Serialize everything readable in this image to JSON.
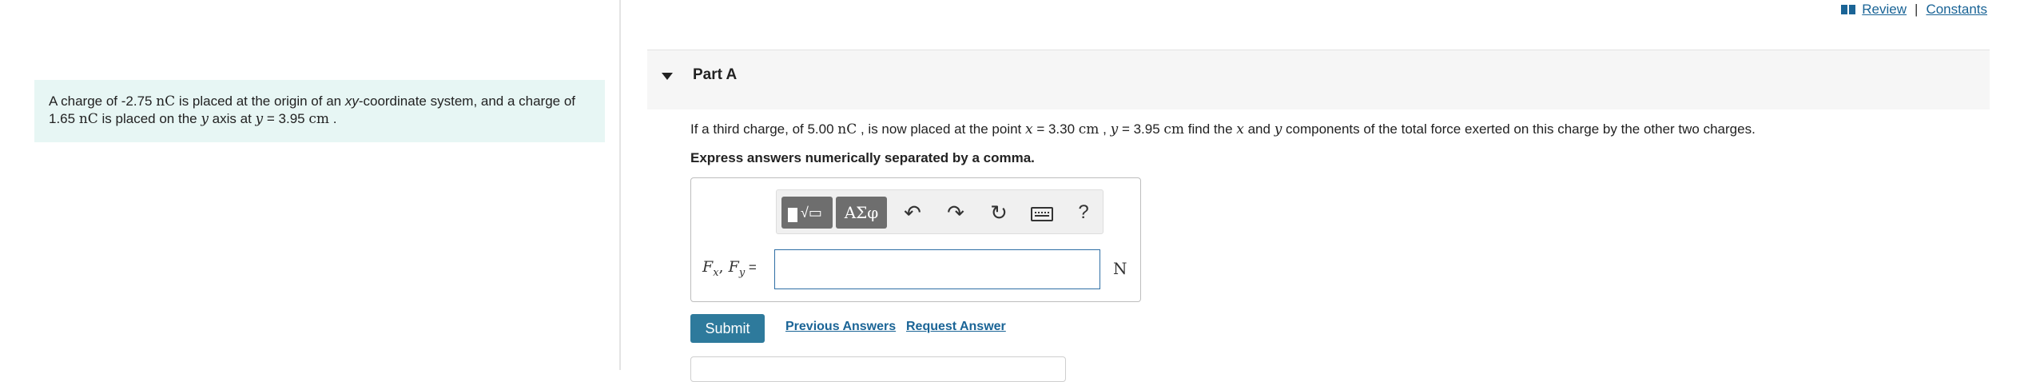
{
  "header": {
    "review": "Review",
    "separator": "|",
    "constants": "Constants"
  },
  "problem": {
    "t1": "A charge of ",
    "q1": "-2.75",
    "u1": "nC",
    "t2": " is placed at the origin of an ",
    "xy": "xy",
    "t3": "-coordinate system, and a charge of",
    "q2": "1.65",
    "u2": "nC",
    "t4": " is placed on the ",
    "yvar": "y",
    "t5": " axis at ",
    "yvar2": "y",
    "t6": " = 3.95 ",
    "u3": "cm",
    "t7": " ."
  },
  "part": {
    "title": "Part A"
  },
  "question": {
    "t1": "If a third charge, of 5.00 ",
    "u1": "nC",
    "t2": " , is now placed at the point ",
    "x": "x",
    "t3": " = 3.30 ",
    "u2": "cm",
    "t4": " , ",
    "y": "y",
    "t5": " = 3.95 ",
    "u3": "cm",
    "t6": " find the ",
    "x2": "x",
    "t7": " and ",
    "y2": "y",
    "t8": " components of the total force exerted on this charge by the other two charges."
  },
  "instruction": "Express answers numerically separated by a comma.",
  "toolbar": {
    "radical": "√▭",
    "greek": "ΑΣφ",
    "undo": "↶",
    "redo": "↷",
    "reset": "↻",
    "help": "?"
  },
  "answer": {
    "F": "F",
    "sub_x": "x",
    "comma": ", ",
    "F2": "F",
    "sub_y": "y",
    "eq": " =",
    "value": "",
    "unit": "N"
  },
  "actions": {
    "submit": "Submit",
    "previous": "Previous Answers",
    "request": "Request Answer"
  },
  "colors": {
    "panel_bg": "#e7f6f4",
    "submit_bg": "#2e7a9c",
    "link": "#1a6496"
  }
}
